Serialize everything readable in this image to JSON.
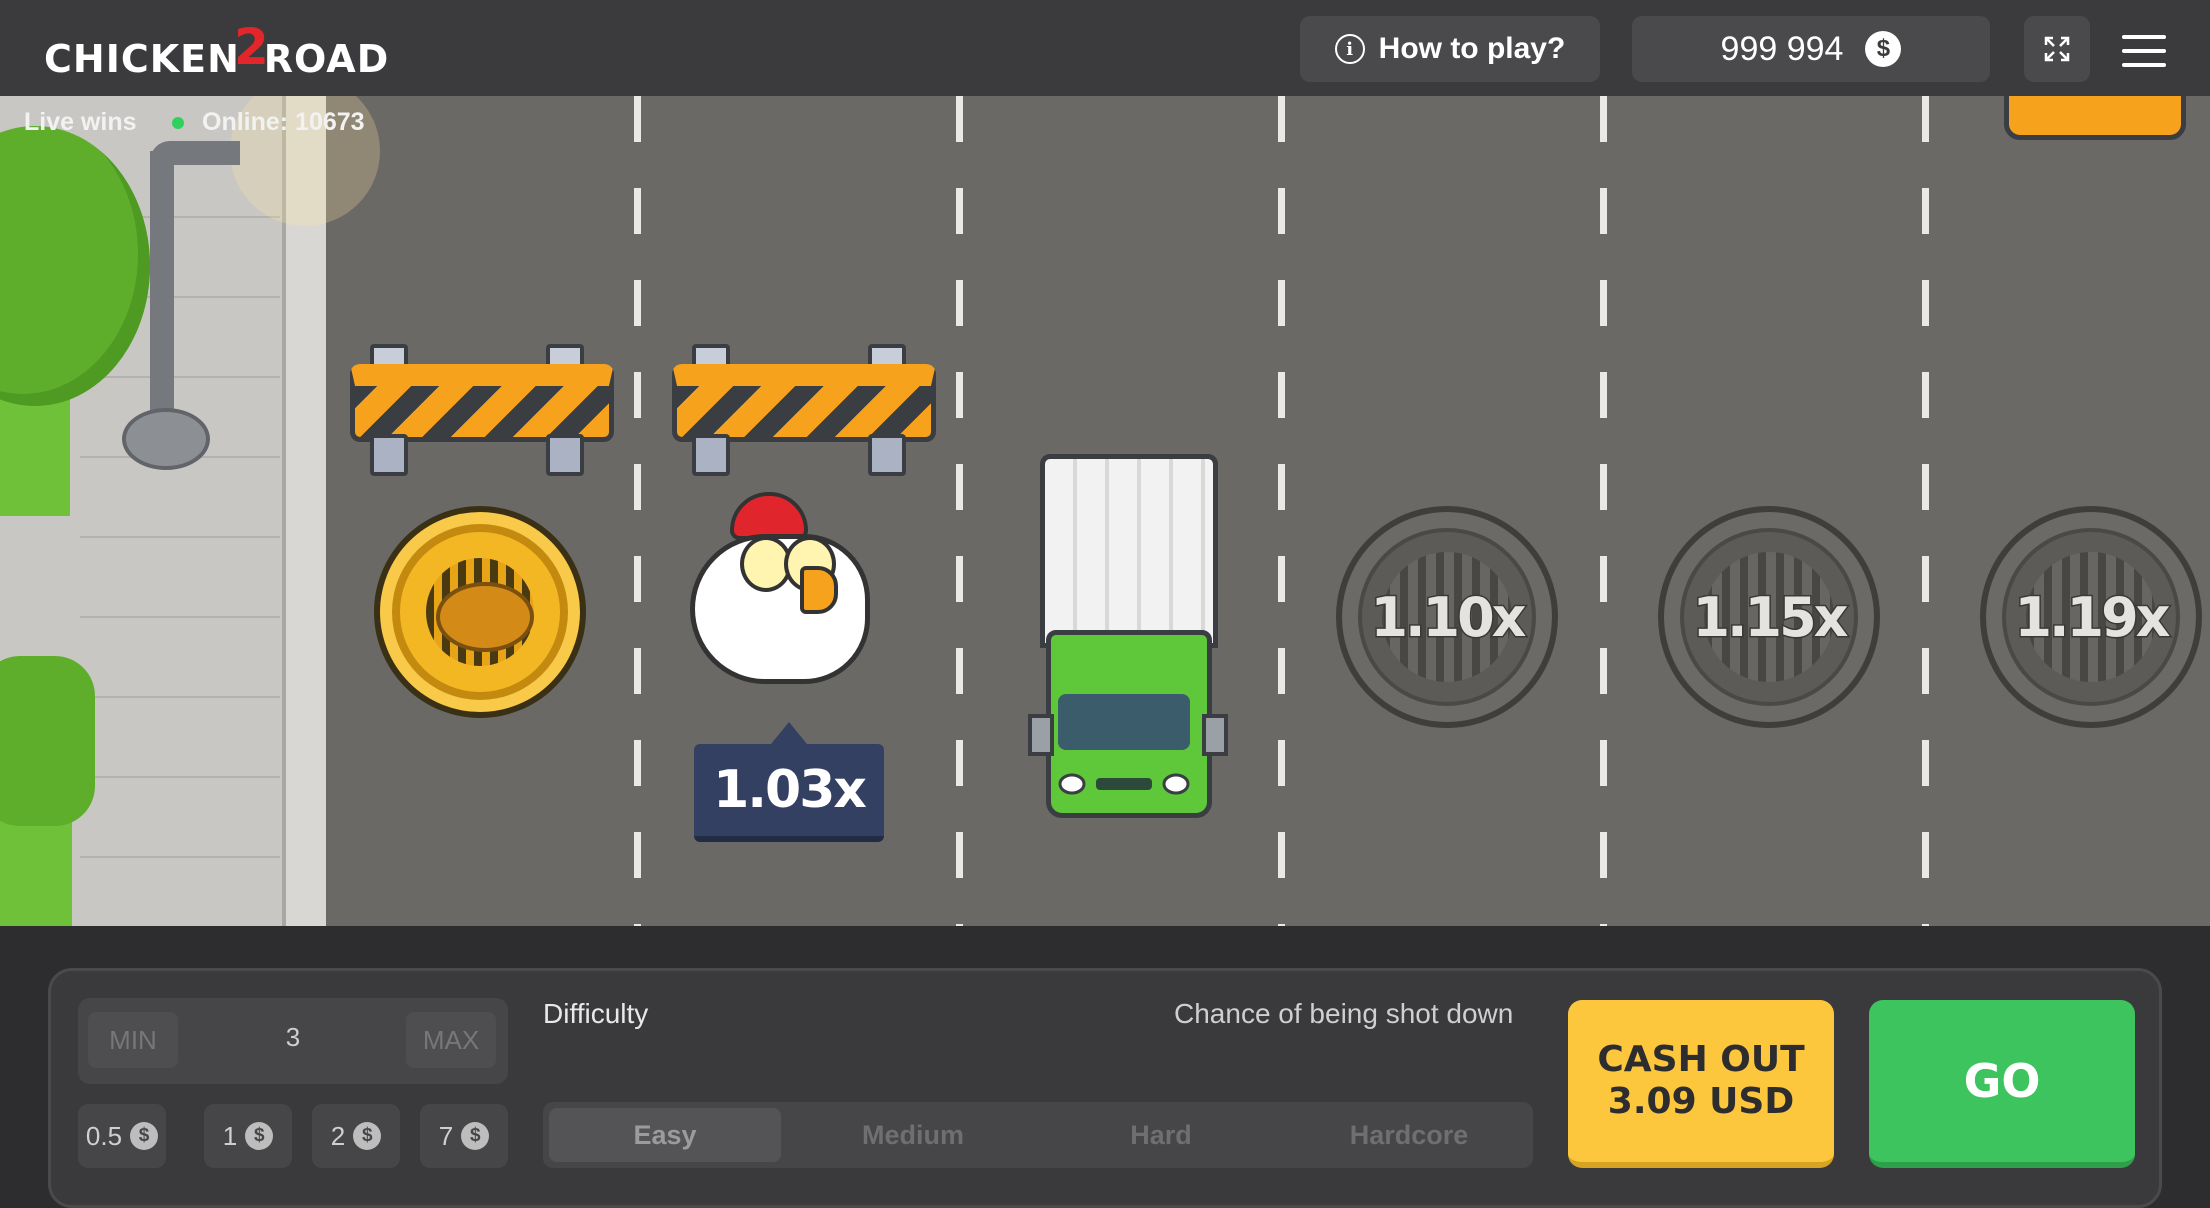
{
  "header": {
    "logo_text_left": "CHICKEN",
    "logo_text_num": "2",
    "logo_text_right": "ROAD",
    "how_to_play": "How to play?",
    "balance": "999 994",
    "currency_icon": "$"
  },
  "status": {
    "live_wins": "Live wins",
    "online": "Online: 10673"
  },
  "game": {
    "current_multiplier": "1.03x",
    "lanes": [
      {
        "multiplier": "1.10x"
      },
      {
        "multiplier": "1.15x"
      },
      {
        "multiplier": "1.19x"
      }
    ]
  },
  "controls": {
    "bet": {
      "min_label": "MIN",
      "value": "3",
      "max_label": "MAX"
    },
    "chips": [
      "0.5",
      "1",
      "2",
      "7"
    ],
    "chip_currency": "$",
    "difficulty_label": "Difficulty",
    "chance_label": "Chance of being shot down",
    "difficulties": [
      "Easy",
      "Medium",
      "Hard",
      "Hardcore"
    ],
    "selected_difficulty": "Easy",
    "cashout_line1": "CASH OUT",
    "cashout_line2": "3.09 USD",
    "go": "GO"
  },
  "colors": {
    "cashout": "#fcc73d",
    "go": "#3ec45e",
    "road": "#6b6966",
    "multiplier_tag": "#344062"
  }
}
